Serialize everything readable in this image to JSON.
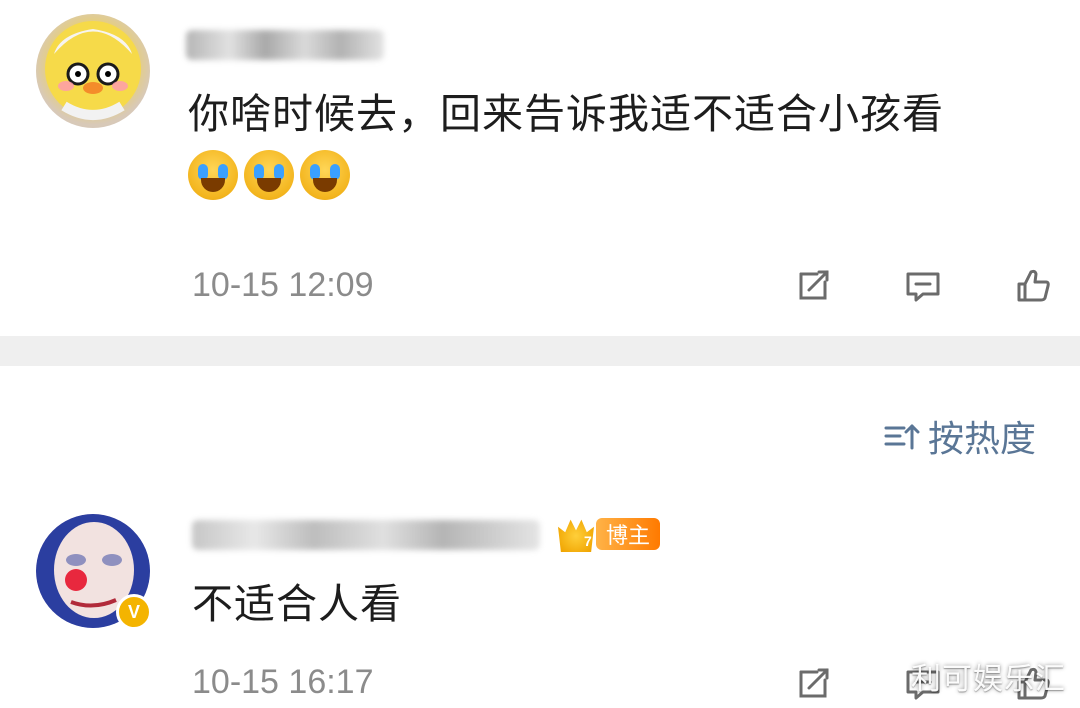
{
  "comments": [
    {
      "text": "你啥时候去，回来告诉我适不适合小孩看",
      "emojis": [
        "crying-laugh",
        "crying-laugh",
        "crying-laugh"
      ],
      "timestamp": "10-15 12:09"
    },
    {
      "text": "不适合人看",
      "badge": {
        "crown_level": "7",
        "label": "博主"
      },
      "timestamp": "10-15 16:17"
    }
  ],
  "sort": {
    "label": "按热度",
    "color": "#5a7696"
  },
  "watermark": "利可娱乐汇"
}
